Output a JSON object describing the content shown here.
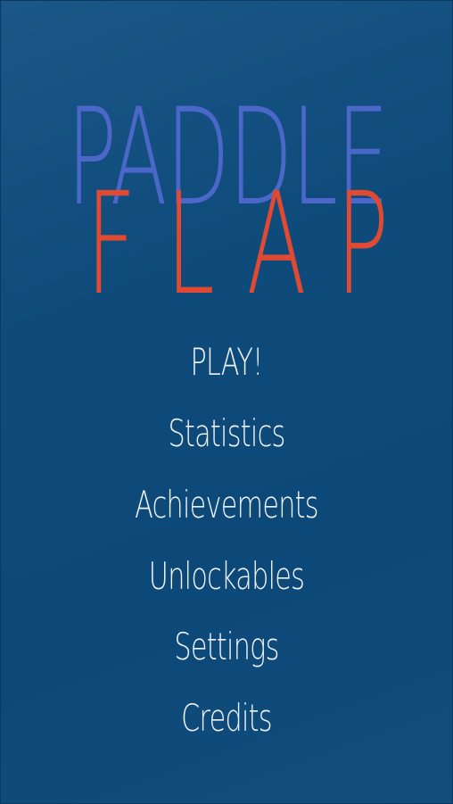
{
  "title": {
    "line1": "PADDLE",
    "line2": "FLAP"
  },
  "menu": {
    "items": [
      {
        "id": "play",
        "label": "PLAY!"
      },
      {
        "id": "statistics",
        "label": "Statistics"
      },
      {
        "id": "achievements",
        "label": "Achievements"
      },
      {
        "id": "unlockables",
        "label": "Unlockables"
      },
      {
        "id": "settings",
        "label": "Settings"
      },
      {
        "id": "credits",
        "label": "Credits"
      }
    ]
  },
  "colors": {
    "background": "#0e4b7b",
    "title_line1": "#4a67c9",
    "title_line2": "#e04a33",
    "menu_text": "#eef3f9"
  }
}
